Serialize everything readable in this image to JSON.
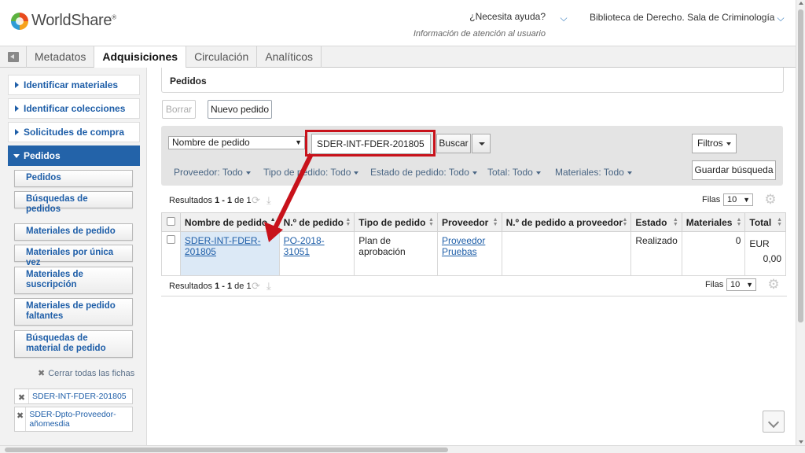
{
  "header": {
    "logo_text": "WorldShare",
    "logo_mark": "®",
    "help_question": "¿Necesita ayuda?",
    "help_sub": "Información de atención al usuario",
    "library": "Biblioteca de Derecho. Sala de Criminología"
  },
  "topnav": {
    "tabs": [
      "Metadatos",
      "Adquisiciones",
      "Circulación",
      "Analíticos"
    ],
    "active": "Adquisiciones"
  },
  "sidebar": {
    "sections": [
      "Identificar materiales",
      "Identificar colecciones",
      "Solicitudes de compra",
      "Pedidos"
    ],
    "buttons": [
      "Pedidos",
      "Búsquedas de pedidos",
      "Materiales de pedido",
      "Materiales por única vez",
      "Materiales de suscripción",
      "Materiales de pedido faltantes",
      "Búsquedas de material de pedido"
    ],
    "close_all": "Cerrar todas las fichas",
    "cards": [
      "SDER-INT-FDER-201805",
      "SDER-Dpto-Proveedor-añomesdia"
    ]
  },
  "main": {
    "title": "Pedidos",
    "btn_delete": "Borrar",
    "btn_new": "Nuevo pedido",
    "search_field": "Nombre de pedido",
    "search_value": "SDER-INT-FDER-201805",
    "btn_search": "Buscar",
    "btn_filters": "Filtros",
    "btn_save_search": "Guardar búsqueda",
    "facets": [
      "Proveedor: Todo",
      "Tipo de pedido: Todo",
      "Estado de pedido: Todo",
      "Total: Todo",
      "Materiales: Todo"
    ],
    "results_prefix": "Resultados ",
    "results_range": "1 - 1",
    "results_of": " de ",
    "results_total": "1",
    "filas_label": "Filas",
    "filas_value": "10"
  },
  "table": {
    "columns": [
      "Nombre de pedido",
      "N.º de pedido",
      "Tipo de pedido",
      "Proveedor",
      "N.º de pedido a proveedor",
      "Estado",
      "Materiales",
      "Total"
    ],
    "row": {
      "name": "SDER-INT-FDER-201805",
      "number": "PO-2018-31051",
      "type": "Plan de aprobación",
      "vendor": "Proveedor Pruebas",
      "vendor_number": "",
      "status": "Realizado",
      "items": "0",
      "currency": "EUR",
      "total": "0,00"
    }
  },
  "colors": {
    "accent": "#2363a9",
    "highlight": "#c8121b"
  }
}
